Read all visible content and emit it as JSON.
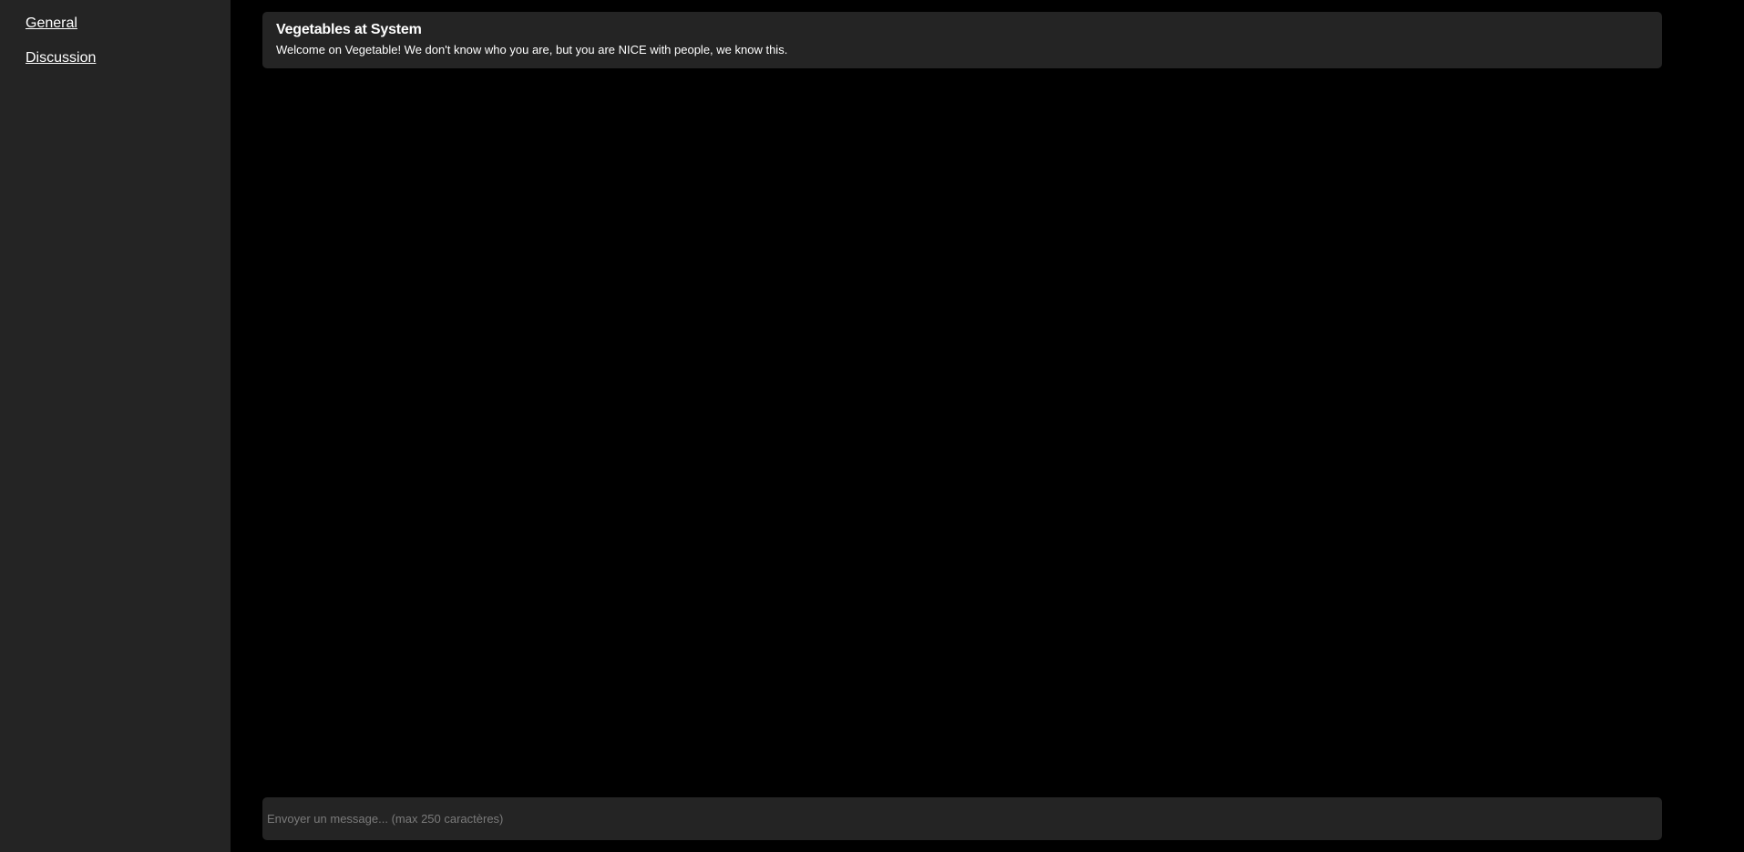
{
  "sidebar": {
    "channels": [
      {
        "label": "General"
      },
      {
        "label": "Discussion"
      }
    ]
  },
  "messages": [
    {
      "author": "Vegetables at System",
      "text": "Welcome on Vegetable! We don't know who you are, but you are NICE with people, we know this."
    }
  ],
  "composer": {
    "value": "",
    "placeholder": "Envoyer un message... (max 250 caractères)"
  },
  "colors": {
    "background": "#000000",
    "panel": "#242424",
    "text": "#ffffff",
    "placeholder": "#7a7a7a"
  }
}
